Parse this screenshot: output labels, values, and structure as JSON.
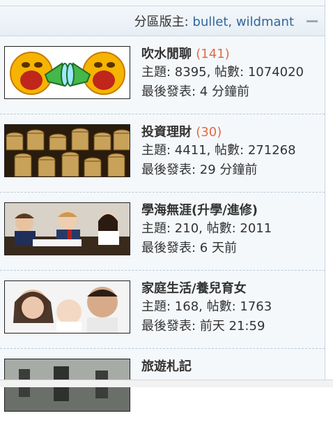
{
  "header": {
    "moderators_label": "分區版主: ",
    "moderators": "bullet, wildmant"
  },
  "forums": [
    {
      "name": "吹水閒聊",
      "today": "(141)",
      "topics_label": "主題: ",
      "topics": "8395",
      "posts_label": ", 帖數: ",
      "posts": "1074020",
      "last_label": "最後發表: ",
      "last": "4 分鐘前",
      "icon": "chat-emoji-thumbnail"
    },
    {
      "name": "投資理財",
      "today": "(30)",
      "topics_label": "主題: ",
      "topics": "4411",
      "posts_label": ", 帖數: ",
      "posts": "271268",
      "last_label": "最後發表: ",
      "last": "29 分鐘前",
      "icon": "coins-thumbnail"
    },
    {
      "name": "學海無涯(升學/進修)",
      "today": "",
      "topics_label": "主題: ",
      "topics": "210",
      "posts_label": ", 帖數: ",
      "posts": "2011",
      "last_label": "最後發表: ",
      "last": "6 天前",
      "icon": "students-thumbnail"
    },
    {
      "name": "家庭生活/養兒育女",
      "today": "",
      "topics_label": "主題: ",
      "topics": "168",
      "posts_label": ", 帖數: ",
      "posts": "1763",
      "last_label": "最後發表: ",
      "last": "前天 21:59",
      "icon": "family-thumbnail"
    },
    {
      "name": "旅遊札記",
      "today": "",
      "icon": "travel-thumbnail"
    }
  ],
  "colors": {
    "link": "#336699",
    "today_count": "#e26a44",
    "border": "#c9d7e3"
  }
}
